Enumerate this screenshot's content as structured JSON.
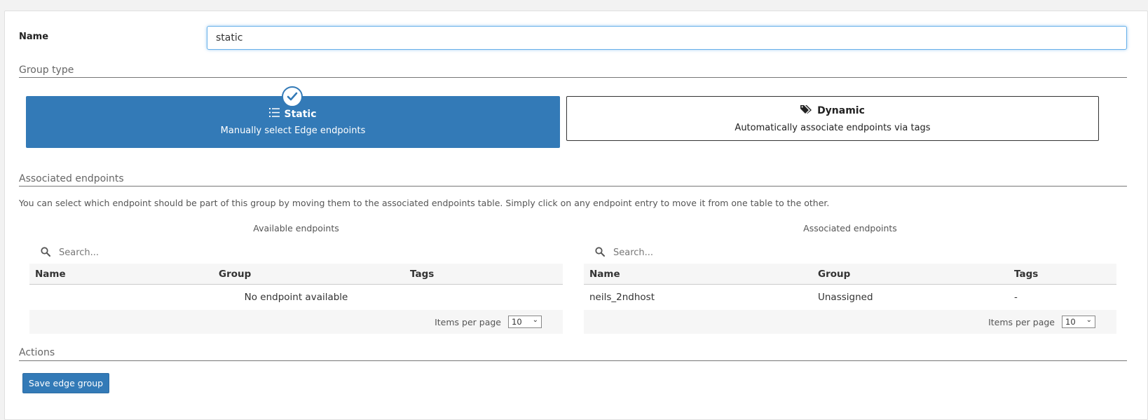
{
  "form": {
    "name_label": "Name",
    "name_value": "static"
  },
  "group_type": {
    "section_title": "Group type",
    "static": {
      "title": "Static",
      "description": "Manually select Edge endpoints",
      "selected": true,
      "icon": "list-icon"
    },
    "dynamic": {
      "title": "Dynamic",
      "description": "Automatically associate endpoints via tags",
      "selected": false,
      "icon": "tags-icon"
    }
  },
  "associated": {
    "section_title": "Associated endpoints",
    "help_text": "You can select which endpoint should be part of this group by moving them to the associated endpoints table. Simply click on any endpoint entry to move it from one table to the other."
  },
  "available_table": {
    "caption": "Available endpoints",
    "search_placeholder": "Search...",
    "columns": [
      "Name",
      "Group",
      "Tags"
    ],
    "empty_message": "No endpoint available",
    "items_per_page_label": "Items per page",
    "items_per_page": "10"
  },
  "associated_table": {
    "caption": "Associated endpoints",
    "search_placeholder": "Search...",
    "columns": [
      "Name",
      "Group",
      "Tags"
    ],
    "rows": [
      {
        "name": "neils_2ndhost",
        "group": "Unassigned",
        "tags": "-"
      }
    ],
    "items_per_page_label": "Items per page",
    "items_per_page": "10"
  },
  "actions": {
    "section_title": "Actions",
    "save_label": "Save edge group"
  },
  "colors": {
    "primary": "#337ab7",
    "focus_border": "#66afe9"
  }
}
